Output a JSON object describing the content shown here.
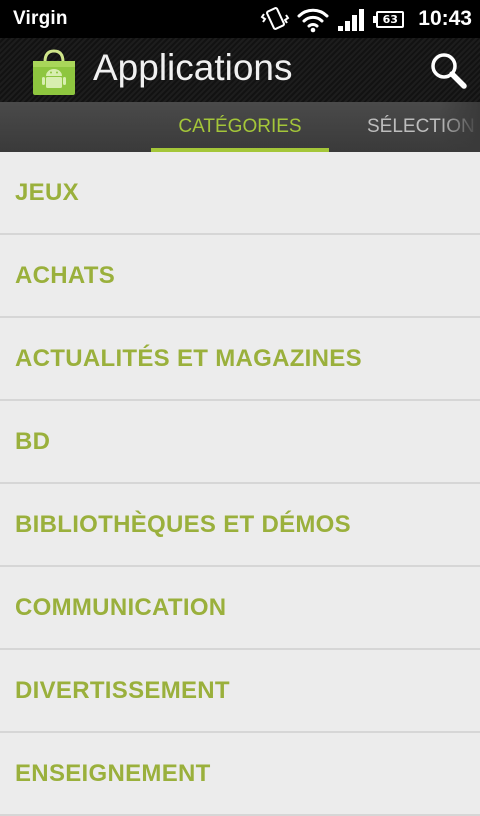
{
  "status_bar": {
    "carrier": "Virgin",
    "battery_level": "63",
    "time": "10:43",
    "icons": [
      "vibrate-icon",
      "wifi-icon",
      "signal-icon",
      "battery-icon"
    ]
  },
  "action_bar": {
    "title": "Applications",
    "app_icon": "market-bag-icon",
    "search_icon": "search-icon"
  },
  "tabs": [
    {
      "label": "CATÉGORIES",
      "selected": true
    },
    {
      "label": "SÉLECTION",
      "selected": false
    }
  ],
  "categories": [
    {
      "label": "JEUX"
    },
    {
      "label": "ACHATS"
    },
    {
      "label": "ACTUALITÉS ET MAGAZINES"
    },
    {
      "label": "BD"
    },
    {
      "label": "BIBLIOTHÈQUES ET DÉMOS"
    },
    {
      "label": "COMMUNICATION"
    },
    {
      "label": "DIVERTISSEMENT"
    },
    {
      "label": "ENSEIGNEMENT"
    }
  ],
  "colors": {
    "accent": "#a4c639",
    "list_text": "#9ab03c",
    "list_background": "#ececec"
  }
}
